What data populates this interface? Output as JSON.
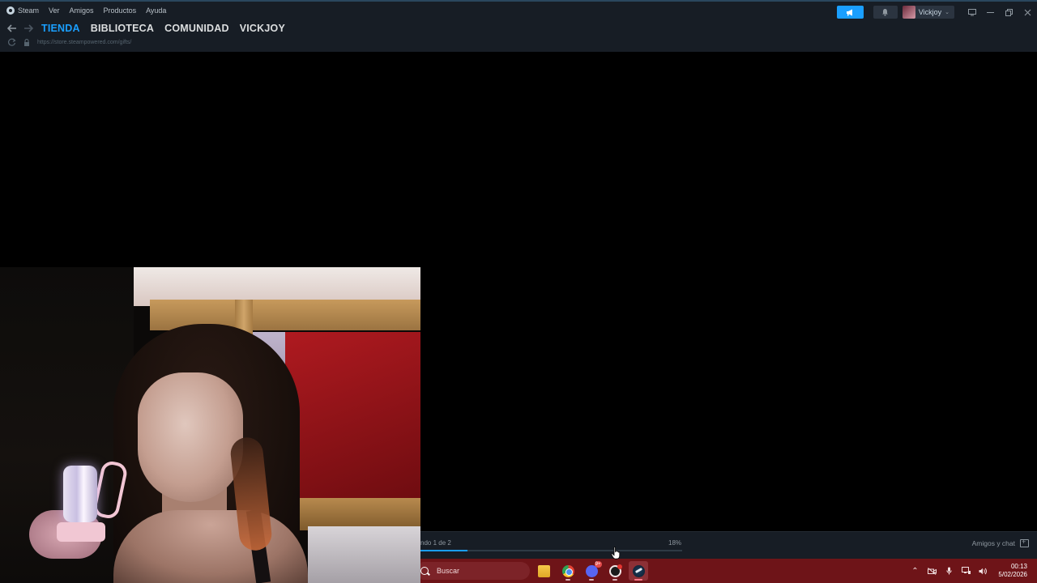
{
  "menu": {
    "app_name": "Steam",
    "items": [
      "Ver",
      "Amigos",
      "Productos",
      "Ayuda"
    ]
  },
  "tabs": [
    {
      "label": "TIENDA",
      "active": true
    },
    {
      "label": "BIBLIOTECA",
      "active": false
    },
    {
      "label": "COMUNIDAD",
      "active": false
    },
    {
      "label": "VICKJOY",
      "active": false
    }
  ],
  "url": "https://store.steampowered.com/gifts/",
  "user": {
    "name": "Vickjoy"
  },
  "download": {
    "status_text": "ndo 1 de 2",
    "percent_text": "18%",
    "progress": 0.18
  },
  "friends_chat_label": "Amigos y chat",
  "taskbar": {
    "search_label": "Buscar",
    "apps": [
      "file-explorer",
      "chrome",
      "discord",
      "clock-app",
      "steam"
    ]
  },
  "clock": {
    "time": "00:13",
    "date": "5/02/2026"
  },
  "colors": {
    "steam_accent": "#1a9fff",
    "titlebar_bg": "#171d25",
    "taskbar_bg": "#6e1418"
  },
  "icons": {
    "back": "arrow-left-icon",
    "forward": "arrow-right-icon",
    "reload": "reload-icon",
    "lock": "lock-icon",
    "announce": "megaphone-icon",
    "notifications": "bell-icon",
    "minimize": "minimize-icon",
    "maximize": "maximize-icon",
    "close": "close-icon"
  }
}
